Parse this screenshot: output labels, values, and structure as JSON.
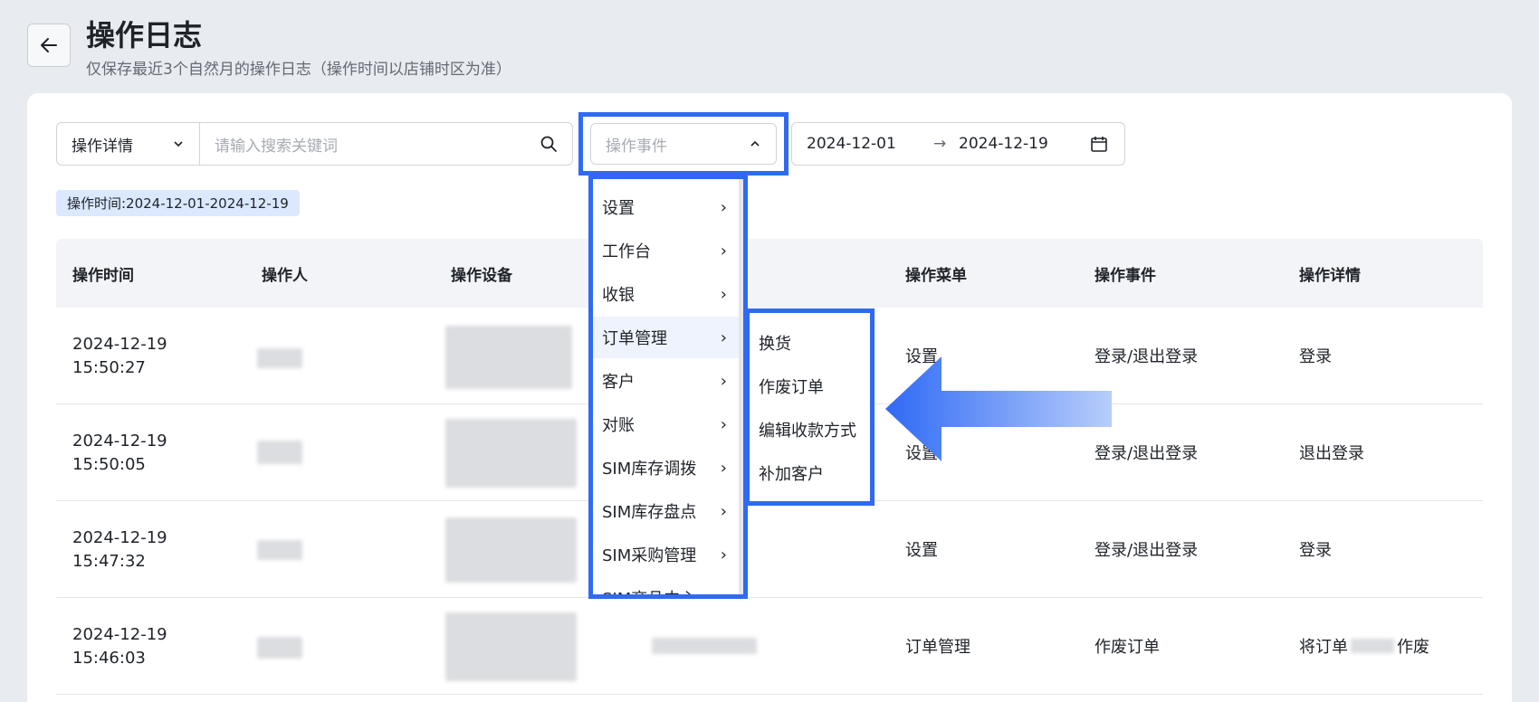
{
  "header": {
    "title": "操作日志",
    "subtitle": "仅保存最近3个自然月的操作日志（操作时间以店铺时区为准）"
  },
  "filters": {
    "detail_select": "操作详情",
    "search_placeholder": "请输入搜索关键词",
    "event_select_placeholder": "操作事件",
    "date_start": "2024-12-01",
    "date_end": "2024-12-19",
    "date_separator": "→"
  },
  "active_tag": "操作时间:2024-12-01-2024-12-19",
  "table": {
    "columns": [
      "操作时间",
      "操作人",
      "操作设备",
      "操作菜单",
      "操作事件",
      "操作详情"
    ],
    "rows": [
      {
        "date": "2024-12-19",
        "time": "15:50:27",
        "menu": "设置",
        "event": "登录/退出登录",
        "detail": "登录"
      },
      {
        "date": "2024-12-19",
        "time": "15:50:05",
        "menu": "设置",
        "event": "登录/退出登录",
        "detail": "退出登录"
      },
      {
        "date": "2024-12-19",
        "time": "15:47:32",
        "menu": "设置",
        "event": "登录/退出登录",
        "detail": "登录"
      },
      {
        "date": "2024-12-19",
        "time": "15:46:03",
        "menu": "订单管理",
        "event": "作废订单",
        "detail_prefix": "将订单",
        "detail_suffix": "作废"
      }
    ]
  },
  "event_menu": {
    "items": [
      "设置",
      "工作台",
      "收银",
      "订单管理",
      "客户",
      "对账",
      "SIM库存调拨",
      "SIM库存盘点",
      "SIM采购管理",
      "SIM商品中心"
    ],
    "active_index": 3
  },
  "event_submenu": {
    "items": [
      "换货",
      "作废订单",
      "编辑收款方式",
      "补加客户"
    ]
  },
  "colors": {
    "highlight": "#2f6af5",
    "background": "#e8ebf0",
    "tag_bg": "#dbe8fd"
  }
}
